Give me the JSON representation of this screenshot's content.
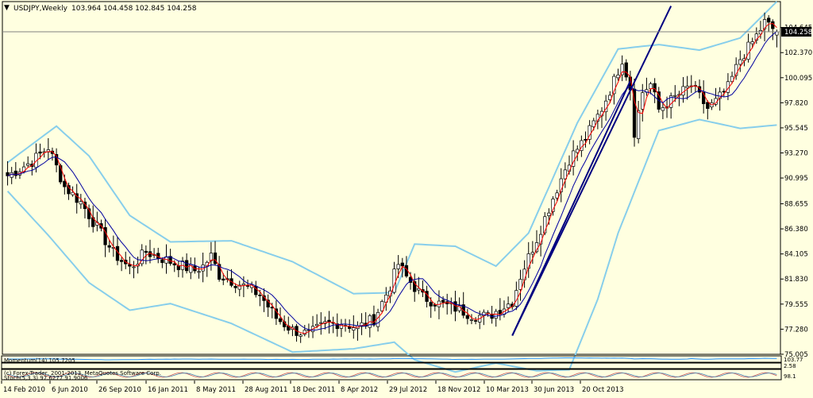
{
  "window": {
    "symbol_label": "USDJPY,Weekly",
    "ohlc_label": "103.964 104.458 102.845 104.258",
    "current_price": "104.258"
  },
  "colors": {
    "background": "#ffffe0",
    "candle": "#000000",
    "bollinger": "#87ceeb",
    "ma_red": "#ff0000",
    "ma_blue": "#0000a0",
    "trendline": "#000080",
    "grid_text": "#000000"
  },
  "panels": {
    "momentum_label": "Momentum(14) 105.7205",
    "momentum_right_label": "103.77",
    "third_label": "(c) Forex-Trader, 2001-2013, MetaQuotes Software Corp.",
    "third_right_label": "2.58",
    "stoch_label": "Stoch(5,3,3) 97.6277 91.9006",
    "stoch_right_label": "98.1"
  },
  "chart_data": {
    "type": "candlestick",
    "title": "USDJPY,Weekly",
    "ylim": [
      75.0,
      107.0
    ],
    "y_ticks": [
      "104.645",
      "102.370",
      "100.095",
      "97.820",
      "95.545",
      "93.270",
      "90.995",
      "88.655",
      "86.380",
      "84.105",
      "81.830",
      "79.555",
      "77.280",
      "75.005"
    ],
    "x_ticks": [
      "14 Feb 2010",
      "6 Jun 2010",
      "26 Sep 2010",
      "16 Jan 2011",
      "8 May 2011",
      "28 Aug 2011",
      "18 Dec 2011",
      "8 Apr 2012",
      "29 Jul 2012",
      "18 Nov 2012",
      "10 Mar 2013",
      "30 Jun 2013",
      "20 Oct 2013"
    ],
    "current_value": 104.258,
    "last_bar": {
      "open": 103.964,
      "high": 104.458,
      "low": 102.845,
      "close": 104.258
    },
    "close_anchors": [
      [
        0,
        91.2
      ],
      [
        6,
        92.5
      ],
      [
        10,
        93.8
      ],
      [
        14,
        90.2
      ],
      [
        18,
        88.8
      ],
      [
        22,
        86.5
      ],
      [
        26,
        84.2
      ],
      [
        30,
        82.8
      ],
      [
        34,
        84.3
      ],
      [
        40,
        83.4
      ],
      [
        46,
        82.6
      ],
      [
        48,
        83.0
      ],
      [
        50,
        83.9
      ],
      [
        52,
        82.2
      ],
      [
        58,
        81.2
      ],
      [
        62,
        80.4
      ],
      [
        66,
        78.3
      ],
      [
        70,
        77.2
      ],
      [
        74,
        76.8
      ],
      [
        78,
        77.7
      ],
      [
        82,
        77.9
      ],
      [
        86,
        77.4
      ],
      [
        90,
        78.2
      ],
      [
        94,
        81.2
      ],
      [
        96,
        83.2
      ],
      [
        98,
        82.0
      ],
      [
        102,
        80.2
      ],
      [
        106,
        79.6
      ],
      [
        110,
        79.2
      ],
      [
        114,
        78.6
      ],
      [
        118,
        78.4
      ],
      [
        120,
        78.9
      ],
      [
        124,
        79.8
      ],
      [
        126,
        82.1
      ],
      [
        130,
        85.5
      ],
      [
        134,
        89.2
      ],
      [
        138,
        92.7
      ],
      [
        142,
        94.6
      ],
      [
        146,
        97.3
      ],
      [
        149,
        99.8
      ],
      [
        151,
        101.8
      ],
      [
        153,
        99.2
      ],
      [
        154,
        95.2
      ],
      [
        156,
        98.8
      ],
      [
        158,
        99.5
      ],
      [
        160,
        97.2
      ],
      [
        164,
        98.3
      ],
      [
        168,
        99.4
      ],
      [
        172,
        97.3
      ],
      [
        174,
        97.9
      ],
      [
        177,
        99.2
      ],
      [
        180,
        101.8
      ],
      [
        183,
        103.3
      ],
      [
        186,
        105.1
      ],
      [
        189,
        104.26
      ]
    ],
    "bollinger_upper_anchors": [
      [
        0,
        92.4
      ],
      [
        12,
        95.7
      ],
      [
        20,
        93.0
      ],
      [
        30,
        87.6
      ],
      [
        40,
        85.2
      ],
      [
        55,
        85.3
      ],
      [
        70,
        83.4
      ],
      [
        85,
        80.5
      ],
      [
        95,
        80.6
      ],
      [
        100,
        85.0
      ],
      [
        110,
        84.8
      ],
      [
        120,
        83.0
      ],
      [
        128,
        86.0
      ],
      [
        140,
        96.0
      ],
      [
        150,
        102.7
      ],
      [
        160,
        103.1
      ],
      [
        170,
        102.6
      ],
      [
        180,
        103.7
      ],
      [
        189,
        107.0
      ]
    ],
    "bollinger_lower_anchors": [
      [
        0,
        89.8
      ],
      [
        10,
        85.8
      ],
      [
        20,
        81.5
      ],
      [
        30,
        79.0
      ],
      [
        40,
        79.6
      ],
      [
        55,
        77.8
      ],
      [
        70,
        75.2
      ],
      [
        85,
        75.5
      ],
      [
        95,
        76.1
      ],
      [
        100,
        74.5
      ],
      [
        110,
        73.4
      ],
      [
        120,
        74.2
      ],
      [
        130,
        73.5
      ],
      [
        138,
        73.6
      ],
      [
        145,
        80.0
      ],
      [
        150,
        86.0
      ],
      [
        160,
        95.3
      ],
      [
        170,
        96.3
      ],
      [
        180,
        95.5
      ],
      [
        189,
        95.8
      ]
    ],
    "trendlines": [
      {
        "from": [
          124,
          76.7
        ],
        "to": [
          163,
          106.6
        ]
      },
      {
        "from": [
          124,
          76.7
        ],
        "to": [
          153,
          99.8
        ]
      }
    ]
  }
}
